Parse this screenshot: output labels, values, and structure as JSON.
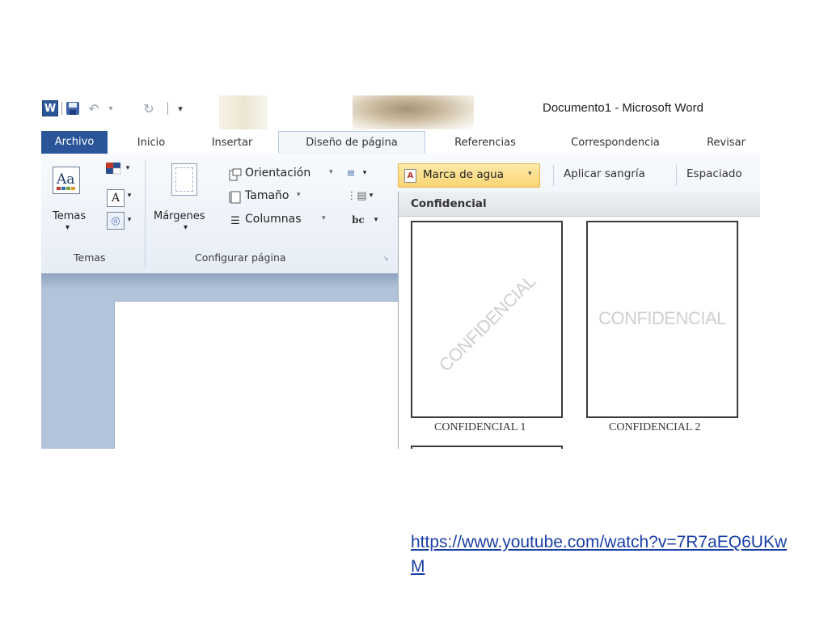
{
  "window": {
    "title": "Documento1  -  Microsoft Word"
  },
  "tabs": [
    {
      "label": "Archivo"
    },
    {
      "label": "Inicio"
    },
    {
      "label": "Insertar"
    },
    {
      "label": "Diseño de página"
    },
    {
      "label": "Referencias"
    },
    {
      "label": "Correspondencia"
    },
    {
      "label": "Revisar"
    }
  ],
  "ribbon": {
    "temas": {
      "button_label": "Temas",
      "group_label": "Temas"
    },
    "configurar": {
      "margenes_label": "Márgenes",
      "orientacion_label": "Orientación",
      "tamano_label": "Tamaño",
      "columnas_label": "Columnas",
      "group_label": "Configurar página"
    },
    "marca_de_agua_label": "Marca de agua",
    "aplicar_sangria_label": "Aplicar sangría",
    "espaciado_label": "Espaciado"
  },
  "watermark_gallery": {
    "section_title": "Confidencial",
    "items": [
      {
        "preview_text": "CONFIDENCIAL",
        "label": "CONFIDENCIAL 1",
        "style": "diagonal"
      },
      {
        "preview_text": "CONFIDENCIAL",
        "label": "CONFIDENCIAL 2",
        "style": "horizontal"
      }
    ]
  },
  "link": {
    "url": "https://www.youtube.com/watch?v=7R7aEQ6UKwM"
  },
  "colors": {
    "archivo_tab": "#2a5699",
    "highlight": "#fbd575",
    "link": "#1a3fa8"
  }
}
